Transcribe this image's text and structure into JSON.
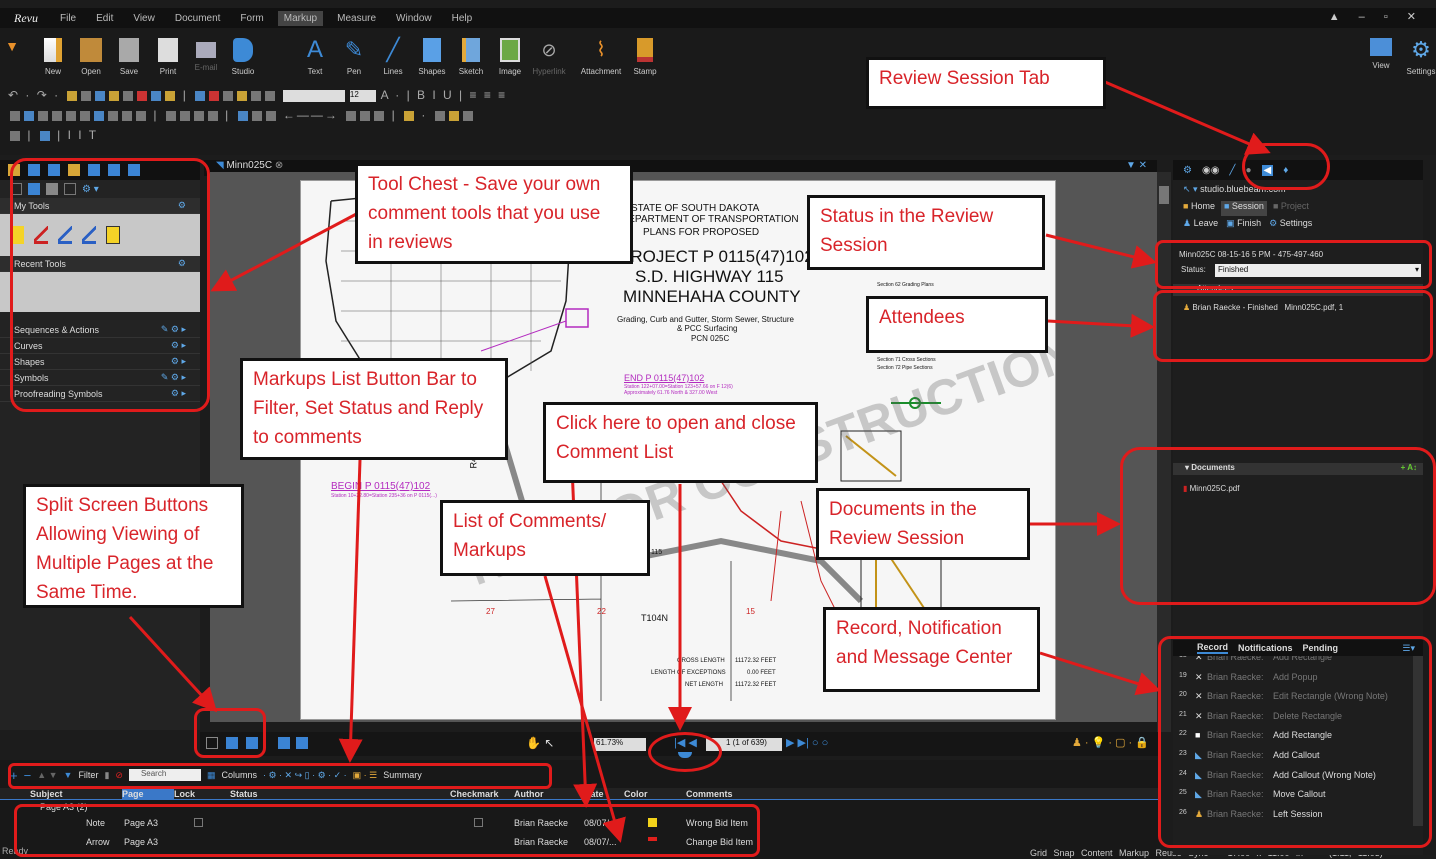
{
  "menubar": {
    "logo": "Revu",
    "items": [
      "File",
      "Edit",
      "View",
      "Document",
      "Form",
      "Markup",
      "Measure",
      "Window",
      "Help"
    ],
    "active": "Markup"
  },
  "ribbon": {
    "file_buttons": [
      {
        "icon": "new-icon",
        "label": "New",
        "dim": false
      },
      {
        "icon": "open-folder-icon",
        "label": "Open",
        "dim": false
      },
      {
        "icon": "save-icon",
        "label": "Save",
        "dim": false
      },
      {
        "icon": "print-icon",
        "label": "Print",
        "dim": false
      },
      {
        "icon": "email-icon",
        "label": "E-mail",
        "dim": true
      },
      {
        "icon": "studio-icon",
        "label": "Studio",
        "dim": false
      }
    ],
    "markup_buttons": [
      {
        "icon": "text-icon",
        "label": "Text",
        "dim": false
      },
      {
        "icon": "pen-icon",
        "label": "Pen",
        "dim": false
      },
      {
        "icon": "lines-icon",
        "label": "Lines",
        "dim": false
      },
      {
        "icon": "shapes-icon",
        "label": "Shapes",
        "dim": false
      },
      {
        "icon": "sketch-icon",
        "label": "Sketch",
        "dim": false
      },
      {
        "icon": "image-icon",
        "label": "Image",
        "dim": false
      },
      {
        "icon": "hyperlink-icon",
        "label": "Hyperlink",
        "dim": true
      },
      {
        "icon": "attachment-icon",
        "label": "Attachment",
        "dim": false
      },
      {
        "icon": "stamp-icon",
        "label": "Stamp",
        "dim": false
      }
    ],
    "right_buttons": [
      {
        "icon": "view-icon",
        "label": "View"
      },
      {
        "icon": "settings-icon",
        "label": "Settings"
      }
    ],
    "font_size": "12"
  },
  "left_panel": {
    "my_tools": "My Tools",
    "recent_tools": "Recent Tools",
    "sections": [
      "Sequences & Actions",
      "Curves",
      "Shapes",
      "Symbols",
      "Proofreading Symbols"
    ]
  },
  "document": {
    "tab": "Minn025C",
    "title_lines": [
      "STATE OF SOUTH DAKOTA",
      "DEPARTMENT OF TRANSPORTATION",
      "PLANS FOR PROPOSED"
    ],
    "project": "PROJECT P 0115(47)102",
    "highway": "S.D. HIGHWAY 115",
    "county": "MINNEHAHA COUNTY",
    "desc1": "Grading, Curb and Gutter, Storm Sewer, Structure",
    "desc2": "& PCC Surfacing",
    "pcn": "PCN 025C",
    "index1": "Section 62 Grading Plans",
    "index2": "Section 71 Cross Sections",
    "index3": "Section 72 Pipe Sections",
    "end": "END P 0115(47)102",
    "end_sub1": "Station 122+07.00=Station 123+57.66 on F 12(6)",
    "end_sub2": "Approximately 61.76 North & 327.00 West",
    "begin": "BEGIN P 0115(47)102",
    "begin_sub": "Station 10+22.80=Station 235+36 on P 0115(...)",
    "r49": "R49W",
    "t104": "T104N",
    "n27": "27",
    "n22": "22",
    "n15": "15",
    "label115": "115",
    "len1": "GROSS LENGTH",
    "len1v": "11172.32 FEET",
    "len2": "LENGTH OF EXCEPTIONS",
    "len2v": "0.00 FEET",
    "len3": "NET LENGTH",
    "len3v": "11172.32 FEET",
    "watermark": "NOT FOR CONSTRUCTION"
  },
  "navbar": {
    "zoom": "61.73%",
    "page": "1 (1 of 639)"
  },
  "markups": {
    "toolbar": {
      "filter": "Filter",
      "search": "Search",
      "columns": "Columns",
      "summary": "Summary"
    },
    "headers": [
      "Subject",
      "Page",
      "Lock",
      "Status",
      "Checkmark",
      "Author",
      "Date",
      "Color",
      "Comments"
    ],
    "group": "Page A3 (2)",
    "rows": [
      {
        "subject": "Note",
        "page": "Page A3",
        "author": "Brian Raecke",
        "date": "08/07/...",
        "color": "#f2d21a",
        "comment": "Wrong Bid Item"
      },
      {
        "subject": "Arrow",
        "page": "Page A3",
        "author": "Brian Raecke",
        "date": "08/07/...",
        "color": "#e0201c",
        "comment": "Change Bid Item"
      }
    ]
  },
  "status_bar": {
    "ready": "Ready",
    "items": "Grid Snap Content Markup Reuse Sync",
    "size": "17.00 x 11.00 in",
    "coords": "(1.11, 11.03)"
  },
  "studio": {
    "server": "studio.bluebeam.com",
    "home": "Home",
    "session": "Session",
    "project": "Project",
    "leave": "Leave",
    "finish": "Finish",
    "settings": "Settings",
    "session_id": "Minn025C 08-15-16 5 PM - 475-497-460",
    "status_label": "Status:",
    "status_value": "Finished",
    "attendees_header": "Attendees",
    "attendee": "Brian Raecke - Finished",
    "attendee_file": "Minn025C.pdf, 1",
    "documents_header": "Documents",
    "document": "Minn025C.pdf"
  },
  "record": {
    "tabs": [
      "Record",
      "Notifications",
      "Pending"
    ],
    "entries": [
      {
        "n": "18",
        "user": "Brian Raecke:",
        "action": "Add Rectangle",
        "icon": "x"
      },
      {
        "n": "19",
        "user": "Brian Raecke:",
        "action": "Add Popup",
        "icon": "x"
      },
      {
        "n": "20",
        "user": "Brian Raecke:",
        "action": "Edit Rectangle (Wrong Note)",
        "icon": "x"
      },
      {
        "n": "21",
        "user": "Brian Raecke:",
        "action": "Delete Rectangle",
        "icon": "x"
      },
      {
        "n": "22",
        "user": "Brian Raecke:",
        "action": "Add Rectangle",
        "icon": "rect"
      },
      {
        "n": "23",
        "user": "Brian Raecke:",
        "action": "Add Callout",
        "icon": "callout"
      },
      {
        "n": "24",
        "user": "Brian Raecke:",
        "action": "Add Callout (Wrong Note)",
        "icon": "callout"
      },
      {
        "n": "25",
        "user": "Brian Raecke:",
        "action": "Move Callout",
        "icon": "callout"
      },
      {
        "n": "26",
        "user": "Brian Raecke:",
        "action": "Left Session",
        "icon": "person"
      }
    ]
  },
  "annotations": {
    "review_tab": "Review Session Tab",
    "tool_chest": "Tool Chest - Save your own comment tools that you use in reviews",
    "status": "Status in the Review Session",
    "attendees": "Attendees",
    "markups_bar": "Markups List Button Bar to Filter, Set Status and Reply to comments",
    "comment_list": "Click here to open and close Comment List",
    "split": "Split Screen Buttons Allowing Viewing of Multiple Pages at the Same Time.",
    "list": "List of Comments/ Markups",
    "documents": "Documents in the Review Session",
    "record": "Record, Notification and Message Center"
  }
}
